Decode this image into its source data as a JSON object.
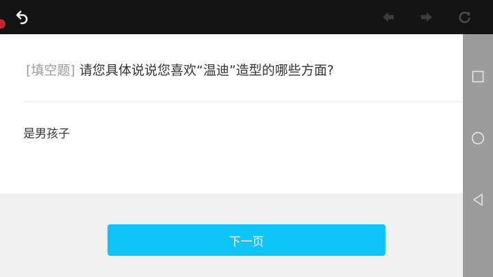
{
  "toolbar": {
    "icons": [
      "back-arrow-icon",
      "prev-icon",
      "next-icon",
      "refresh-icon"
    ]
  },
  "question": {
    "type_tag": "[填空题]",
    "text": "请您具体说说您喜欢“温迪”造型的哪些方面?"
  },
  "answer": {
    "value": "是男孩子"
  },
  "footer": {
    "next_label": "下一页"
  },
  "system_nav": {
    "icons": [
      "recents-square-icon",
      "home-circle-icon",
      "back-triangle-icon"
    ]
  },
  "colors": {
    "toolbar_bg": "#131515",
    "accent_button": "#0fc4f6",
    "nav_bar": "#9c9c9c",
    "page_bg": "#f0f0f0"
  }
}
